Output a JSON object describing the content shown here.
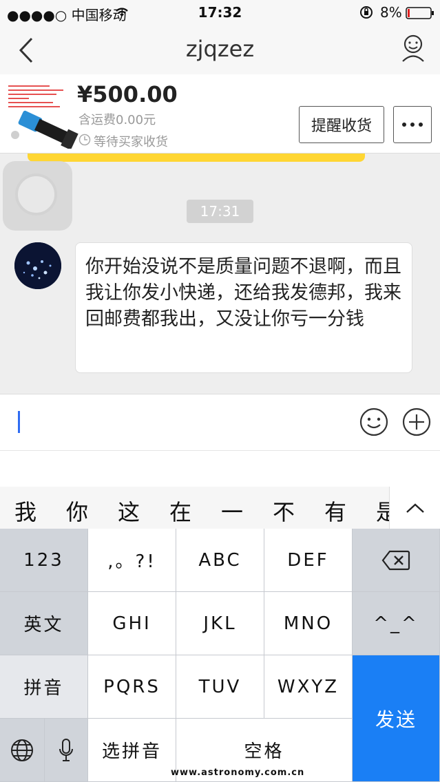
{
  "status_bar": {
    "carrier": "●●●●○ 中国移动",
    "time": "17:32",
    "battery": "8%"
  },
  "nav": {
    "title": "zjqzez"
  },
  "order": {
    "price": "¥500.00",
    "shipping": "含运费0.00元",
    "status": "等待买家收货",
    "remind_button": "提醒收货",
    "more_button": "···"
  },
  "chat": {
    "timestamp": "17:31",
    "messages": [
      {
        "text": "你开始没说不是质量问题不退啊，而且我让你发小快递，还给我发德邦，我来回邮费都我出，又没让你亏一分钱"
      }
    ]
  },
  "candidates": [
    "我",
    "你",
    "这",
    "在",
    "一",
    "不",
    "有",
    "是"
  ],
  "keyboard": {
    "row1": [
      "123",
      ",。?!",
      "ABC",
      "DEF"
    ],
    "row2": [
      "英文",
      "GHI",
      "JKL",
      "MNO",
      "^_^"
    ],
    "row3": [
      "拼音",
      "PQRS",
      "TUV",
      "WXYZ"
    ],
    "row4": [
      "选拼音",
      "空格"
    ],
    "send": "发送"
  },
  "watermark": "www.astronomy.com.cn",
  "colors": {
    "accent": "#1a7ff5",
    "banner": "#ffd633"
  }
}
